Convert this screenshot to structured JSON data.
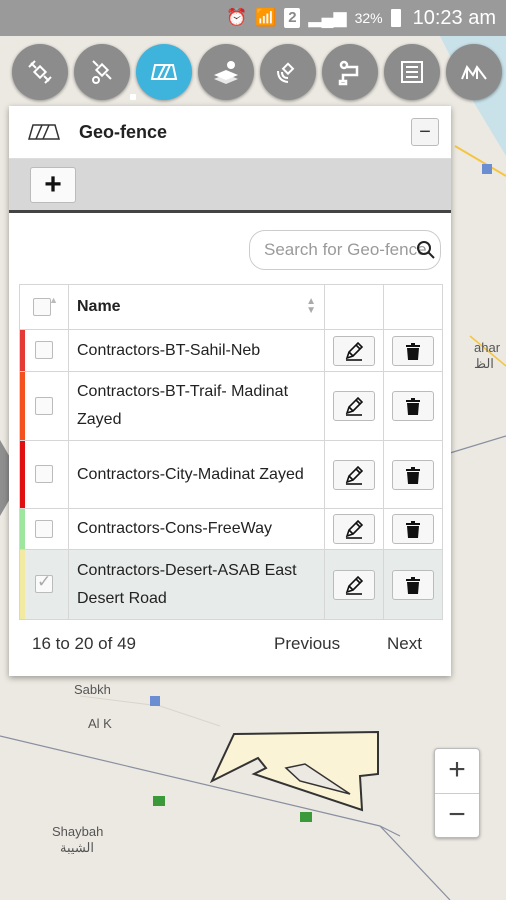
{
  "status_bar": {
    "signal_text": "2",
    "battery_percent": "32%",
    "time": "10:23 am"
  },
  "toolbar": {
    "buttons": [
      {
        "icon": "satellite-icon",
        "active": false
      },
      {
        "icon": "satellite-wrench-icon",
        "active": false
      },
      {
        "icon": "geofence-icon",
        "active": true
      },
      {
        "icon": "layers-marker-icon",
        "active": false
      },
      {
        "icon": "satellite-signal-icon",
        "active": false
      },
      {
        "icon": "route-icon",
        "active": false
      },
      {
        "icon": "list-icon",
        "active": false
      },
      {
        "icon": "map-icon",
        "active": false
      }
    ]
  },
  "panel": {
    "title": "Geo-fence",
    "collapse_label": "−",
    "add_label": "+",
    "search_placeholder": "Search for Geo-fence",
    "columns": {
      "name": "Name"
    },
    "rows": [
      {
        "name": "Contractors-BT-Sahil-Neb",
        "color": "#e53935",
        "checked": false
      },
      {
        "name": "Contractors-BT-Traif- Madinat Zayed",
        "color": "#f4511e",
        "checked": false
      },
      {
        "name": "Contractors-City-Madinat Zayed",
        "color": "#e01010",
        "checked": false
      },
      {
        "name": "Contractors-Cons-FreeWay",
        "color": "#9ee69e",
        "checked": false
      },
      {
        "name": "Contractors-Desert-ASAB East Desert Road",
        "color": "#f2eaa0",
        "checked": true
      }
    ],
    "pager": {
      "info": "16 to 20 of 49",
      "previous": "Previous",
      "next": "Next"
    }
  },
  "map": {
    "labels": {
      "sabkh": "Sabkh",
      "al_k": "Al K",
      "shaybah": "Shaybah",
      "shaybah_ar": "الشيبة",
      "ahar": "ahar",
      "ahar_ar": "الظ"
    }
  },
  "zoom": {
    "in": "+",
    "out": "−"
  }
}
